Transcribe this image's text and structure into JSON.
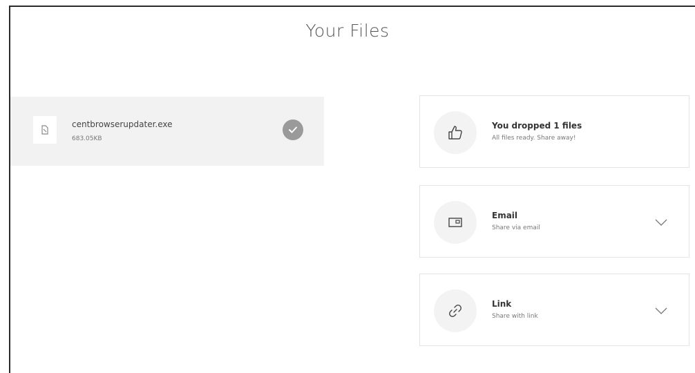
{
  "page": {
    "title": "Your Files"
  },
  "files": [
    {
      "name": "centbrowserupdater.exe",
      "size": "683.05KB",
      "status_icon": "check-circle-icon"
    }
  ],
  "summary_card": {
    "title": "You dropped 1 files",
    "subtitle": "All files ready. Share away!",
    "icon": "thumbs-up-icon"
  },
  "share_options": [
    {
      "title": "Email",
      "subtitle": "Share via email",
      "icon": "email-icon",
      "toggle_icon": "chevron-down-icon"
    },
    {
      "title": "Link",
      "subtitle": "Share with link",
      "icon": "link-icon",
      "toggle_icon": "chevron-down-icon"
    }
  ],
  "colors": {
    "file_row_bg": "#f2f2f2",
    "check_badge": "#9a9a9a",
    "icon_circle_bg": "#f3f3f3",
    "card_border": "#e3e3e3"
  }
}
